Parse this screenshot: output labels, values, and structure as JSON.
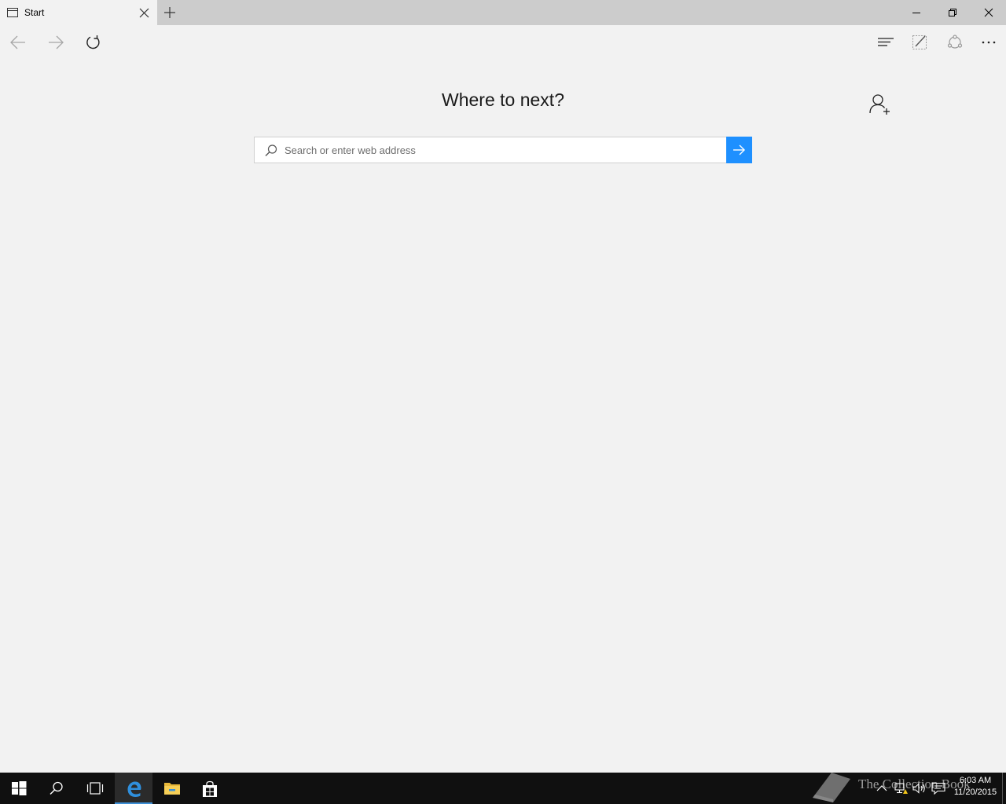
{
  "browser": {
    "tab": {
      "title": "Start",
      "icon": "page-icon"
    },
    "new_tab_icon": "plus-icon",
    "window_controls": [
      "minimize-icon",
      "restore-icon",
      "close-icon"
    ],
    "toolbar": {
      "left": [
        "back-arrow-icon",
        "forward-arrow-icon",
        "refresh-icon"
      ],
      "right": [
        "hub-icon",
        "web-note-icon",
        "share-icon",
        "more-icon"
      ]
    }
  },
  "start_page": {
    "heading": "Where to next?",
    "search": {
      "placeholder": "Search or enter web address",
      "value": ""
    },
    "add_user_icon": "person-add-icon"
  },
  "taskbar": {
    "pinned": [
      "windows-start-icon",
      "search-icon",
      "task-view-icon",
      "edge-icon",
      "file-explorer-icon",
      "store-icon"
    ],
    "active_app": "edge-icon",
    "tray": [
      "chevron-up-icon",
      "network-icon",
      "volume-icon",
      "action-center-icon"
    ],
    "clock": {
      "time": "6:03 AM",
      "date": "11/20/2015"
    },
    "watermark": "The Collection Book"
  },
  "colors": {
    "accent": "#1e90ff",
    "page_background": "#f2f2f2",
    "tabbar_background": "#cccccc",
    "taskbar_background": "#101010"
  }
}
